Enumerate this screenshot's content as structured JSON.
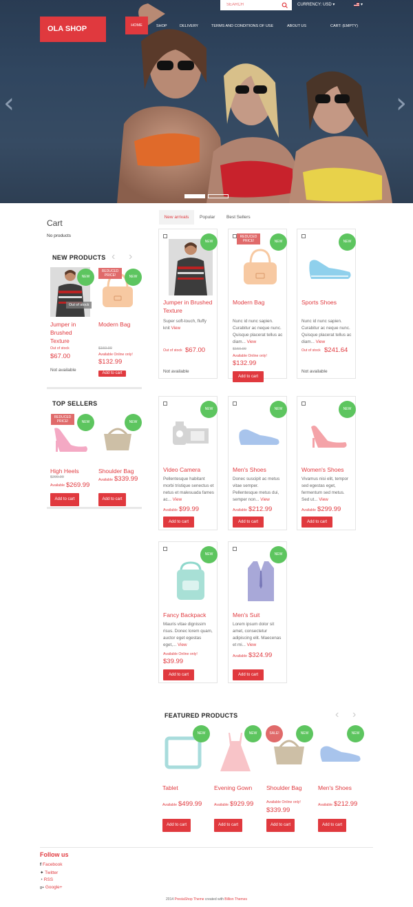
{
  "topbar": {
    "search_placeholder": "SEARCH",
    "currency": "CURRENCY: USD ▾",
    "lang": "▾"
  },
  "logo": "OLA SHOP",
  "nav": [
    "HOME",
    "SHOP",
    "DELIVERY",
    "TERMS AND CONDITIONS OF USE",
    "ABOUT US"
  ],
  "cart_label": "CART: (EMPTY)",
  "sidebar": {
    "cart_title": "Cart",
    "cart_empty": "No products",
    "new_products_title": "NEW PRODUCTS",
    "new_products": [
      {
        "name": "Jumper in Brushed Texture",
        "badge": "NEW",
        "overlay": "Out of stock",
        "avail": "Out of stock",
        "price": "$67.00",
        "status": "Not available"
      },
      {
        "name": "Modern Bag",
        "badge": "NEW",
        "reduced": "REDUCED PRICE!",
        "old": "$150.99",
        "avail": "Available Online only!",
        "price": "$132.99",
        "btn": "Add to cart"
      }
    ],
    "top_sellers_title": "TOP SELLERS",
    "top_sellers": [
      {
        "name": "High Heels",
        "badge": "NEW",
        "reduced": "REDUCED PRICE!",
        "old": "$299.99",
        "avail": "Available",
        "price": "$269.99",
        "btn": "Add to cart"
      },
      {
        "name": "Shoulder Bag",
        "badge": "NEW",
        "avail": "Available",
        "price": "$339.99",
        "btn": "Add to cart"
      }
    ]
  },
  "tabs": [
    "New arrivals",
    "Popular",
    "Best Sellers"
  ],
  "products": [
    {
      "name": "Jumper in Brushed Texture",
      "badge": "NEW",
      "desc": "Super soft-touch, fluffy knit",
      "avail": "Out of stock",
      "price": "$67.00",
      "status": "Not available"
    },
    {
      "name": "Modern Bag",
      "badge": "NEW",
      "reduced": "REDUCED PRICE!",
      "desc": "Nunc id nunc sapien. Curabitur ac neque nunc. Quisque placerat tellus ac diam...",
      "old": "$150.99",
      "avail": "Available Online only!",
      "price": "$132.99",
      "btn": "Add to cart"
    },
    {
      "name": "Sports Shoes",
      "badge": "NEW",
      "desc": "Nunc id nunc sapien. Curabitur ac neque nunc. Quisque placerat tellus ac diam...",
      "avail": "Out of stock",
      "price": "$241.64",
      "status": "Not available"
    },
    {
      "name": "Video Camera",
      "badge": "NEW",
      "desc": "Pellentesque habitant morbi tristique senectus et netus et malesuada fames ac...",
      "avail": "Available",
      "price": "$99.99",
      "btn": "Add to cart"
    },
    {
      "name": "Men's Shoes",
      "badge": "NEW",
      "desc": "Donec suscipit ac metus vitae semper. Pellentesque metus dui, semper non...",
      "avail": "Available",
      "price": "$212.99",
      "btn": "Add to cart"
    },
    {
      "name": "Women's Shoes",
      "badge": "NEW",
      "desc": "Vivamus nisi elit, tempor sed egestas eget, fermentum sed metus. Sed ut...",
      "avail": "Available",
      "price": "$299.99",
      "btn": "Add to cart"
    },
    {
      "name": "Fancy Backpack",
      "badge": "NEW",
      "desc": "Mauris vitae dignissim risus. Donec lorem quam, auctor eget egestas eget,...",
      "avail": "Available Online only!",
      "price": "$39.99",
      "btn": "Add to cart"
    },
    {
      "name": "Men's Suit",
      "badge": "NEW",
      "desc": "Lorem ipsum dolor sit amet, consectetur adipiscing elit. Maecenas et mi...",
      "avail": "Available",
      "price": "$324.99",
      "btn": "Add to cart"
    }
  ],
  "view_label": "View",
  "featured_title": "FEATURED PRODUCTS",
  "featured": [
    {
      "name": "Tablet",
      "badge": "NEW",
      "avail": "Available",
      "price": "$499.99",
      "btn": "Add to cart"
    },
    {
      "name": "Evening Gown",
      "badge": "NEW",
      "avail": "Available",
      "price": "$929.99",
      "btn": "Add to cart"
    },
    {
      "name": "Shoulder Bag",
      "badge": "NEW",
      "sale": "SALE!",
      "avail": "Available Online only!",
      "price": "$339.99",
      "btn": "Add to cart"
    },
    {
      "name": "Men's Shoes",
      "badge": "NEW",
      "avail": "Available",
      "price": "$212.99",
      "btn": "Add to cart"
    }
  ],
  "footer": {
    "follow": "Follow us",
    "links": [
      "Facebook",
      "Twitter",
      "RSS",
      "Google+"
    ],
    "credit_pre": "2014",
    "credit_link1": "PrestaShop Theme",
    "credit_mid": "created with",
    "credit_link2": "Billion Themes"
  },
  "colors": {
    "accent": "#e0393e",
    "badge": "#5dc55f",
    "reduced": "#e06a6a"
  }
}
